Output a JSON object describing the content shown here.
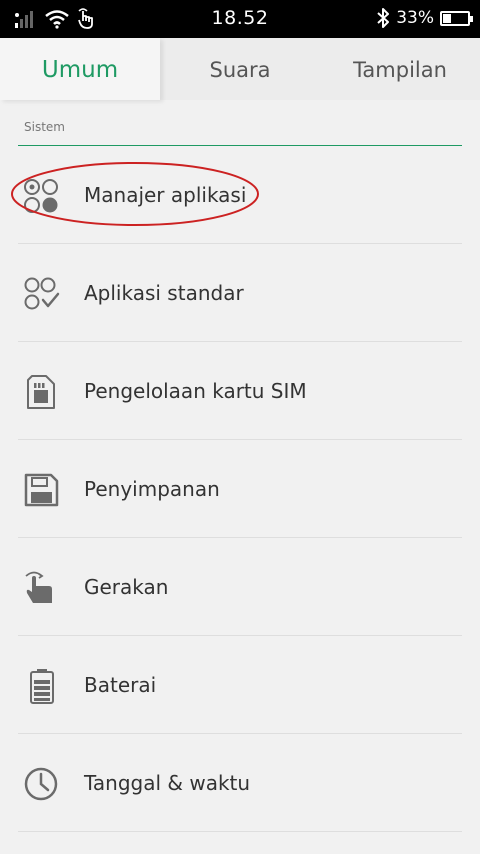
{
  "status_bar": {
    "time": "18.52",
    "battery_text": "33%",
    "battery_level": 0.33,
    "icons": [
      "signal-icon",
      "wifi-icon",
      "gesture-icon",
      "bluetooth-icon",
      "battery-icon"
    ]
  },
  "tabs": [
    {
      "label": "Umum",
      "active": true
    },
    {
      "label": "Suara",
      "active": false
    },
    {
      "label": "Tampilan",
      "active": false
    }
  ],
  "section": {
    "title": "Sistem"
  },
  "items": [
    {
      "label": "Manajer aplikasi",
      "icon": "app-manager-icon",
      "highlighted": true
    },
    {
      "label": "Aplikasi standar",
      "icon": "default-apps-icon"
    },
    {
      "label": "Pengelolaan kartu SIM",
      "icon": "sim-card-icon"
    },
    {
      "label": "Penyimpanan",
      "icon": "storage-icon"
    },
    {
      "label": "Gerakan",
      "icon": "gesture-icon"
    },
    {
      "label": "Baterai",
      "icon": "battery-icon"
    },
    {
      "label": "Tanggal & waktu",
      "icon": "clock-icon"
    }
  ],
  "colors": {
    "accent": "#1e9a63",
    "highlight": "#cc2222",
    "icon": "#6b6b6b"
  }
}
